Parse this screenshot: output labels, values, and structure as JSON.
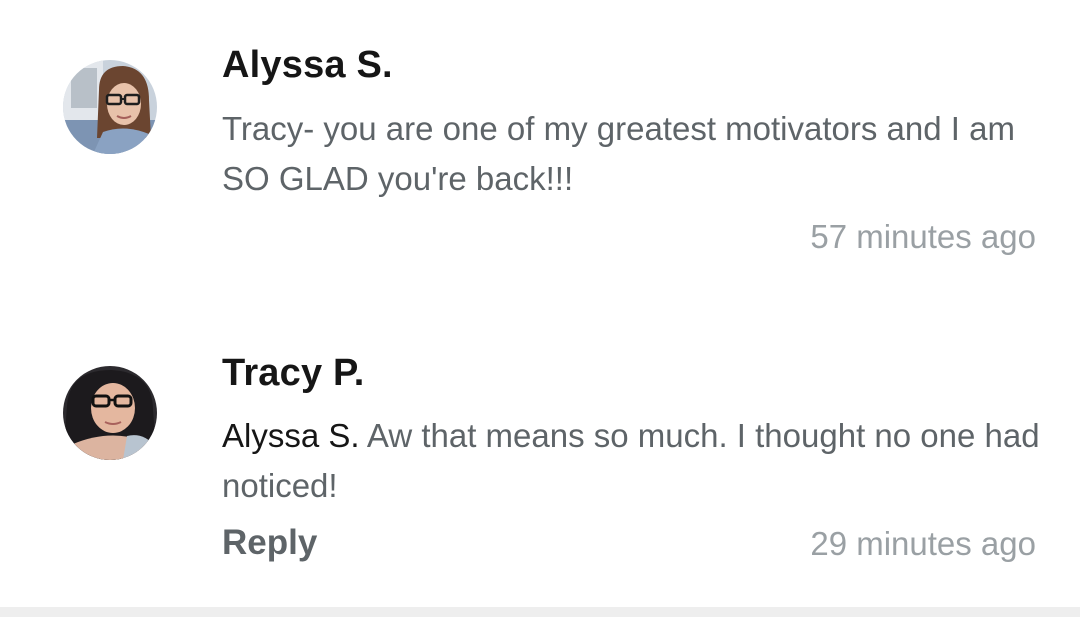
{
  "comments": [
    {
      "author": "Alyssa S.",
      "text": "Tracy- you are one of my greatest motivators and I am SO GLAD you're back!!!",
      "timestamp": "57 minutes ago"
    },
    {
      "author": "Tracy P.",
      "mention": "Alyssa S.",
      "text": "Aw that means so much. I thought no one had noticed!",
      "reply_label": "Reply",
      "timestamp": "29 minutes ago"
    }
  ]
}
